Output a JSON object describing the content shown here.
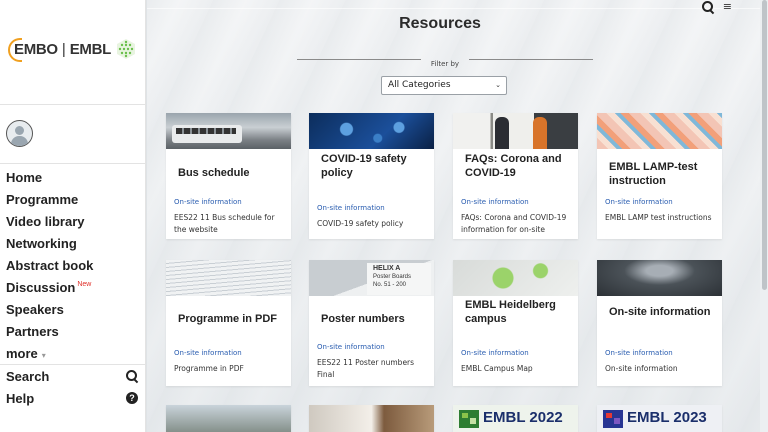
{
  "sidebar": {
    "logo": {
      "embo": "EMBO",
      "sep": "|",
      "embl": "EMBL"
    },
    "nav": [
      {
        "label": "Home"
      },
      {
        "label": "Programme"
      },
      {
        "label": "Video library"
      },
      {
        "label": "Networking"
      },
      {
        "label": "Abstract book"
      },
      {
        "label": "Discussion",
        "badge": "New"
      },
      {
        "label": "Speakers"
      },
      {
        "label": "Partners"
      },
      {
        "label": "more",
        "caret": "▾"
      }
    ],
    "utility": [
      {
        "label": "Search",
        "icon": "search-icon"
      },
      {
        "label": "Help",
        "icon": "help-icon",
        "glyph": "?"
      }
    ]
  },
  "header": {
    "menu_glyph": "≡"
  },
  "main": {
    "title": "Resources",
    "filter_label": "Filter by",
    "category_select": {
      "value": "All Categories",
      "chevron": "⌄"
    },
    "cards": [
      {
        "title": "Bus schedule",
        "category": "On-site information",
        "description": "EES22 11 Bus schedule for the website"
      },
      {
        "title": "COVID-19 safety policy",
        "category": "On-site information",
        "description": "COVID-19 safety policy"
      },
      {
        "title": "FAQs: Corona and COVID-19",
        "category": "On-site information",
        "description": "FAQs: Corona and COVID-19 information for on-site"
      },
      {
        "title": "EMBL LAMP-test instruction",
        "category": "On-site information",
        "description": "EMBL LAMP test instructions"
      },
      {
        "title": "Programme in PDF",
        "category": "On-site information",
        "description": "Programme in PDF"
      },
      {
        "title": "Poster numbers",
        "category": "On-site information",
        "description": "EES22 11 Poster numbers Final"
      },
      {
        "title": "EMBL Heidelberg campus",
        "category": "On-site information",
        "description": "EMBL Campus Map"
      },
      {
        "title": "On-site information",
        "category": "On-site information",
        "description": "On-site information"
      }
    ],
    "poster_sign": {
      "line1": "HELIX A",
      "line2": "Poster Boards",
      "line3": "No. 51 - 200"
    },
    "bottom_cards": [
      {
        "brand": "EMBL",
        "year": "2022"
      },
      {
        "brand": "EMBL",
        "year": "2023"
      }
    ]
  },
  "colors": {
    "accent_link": "#2a5db0",
    "badge": "#e0302a",
    "logo_orange": "#f0a020",
    "logo_green": "#6abf4b"
  }
}
